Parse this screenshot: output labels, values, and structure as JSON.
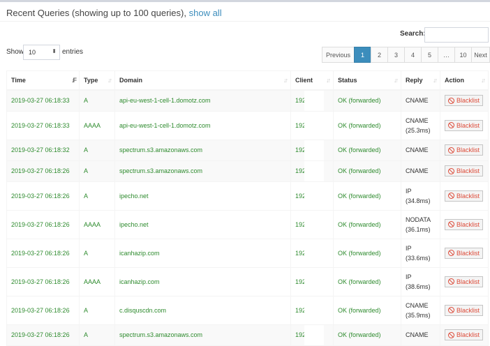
{
  "header": {
    "title": "Recent Queries (showing up to 100 queries),",
    "show_all": "show all"
  },
  "controls": {
    "search_label": "Search:",
    "search_value": "",
    "show_label": "Show",
    "entries_value": "10",
    "entries_label": "entries"
  },
  "pagination": {
    "previous": "Previous",
    "pages": [
      "1",
      "2",
      "3",
      "4",
      "5",
      "…",
      "10"
    ],
    "next": "Next",
    "active": "1"
  },
  "table": {
    "columns": [
      "Time",
      "Type",
      "Domain",
      "Client",
      "Status",
      "Reply",
      "Action"
    ],
    "action_label": "Blacklist",
    "rows": [
      {
        "time": "2019-03-27 06:18:33",
        "type": "A",
        "domain": "api-eu-west-1-cell-1.domotz.com",
        "client": "192",
        "status": "OK (forwarded)",
        "reply": "CNAME",
        "reply_time": ""
      },
      {
        "time": "2019-03-27 06:18:33",
        "type": "AAAA",
        "domain": "api-eu-west-1-cell-1.domotz.com",
        "client": "192",
        "status": "OK (forwarded)",
        "reply": "CNAME",
        "reply_time": "(25.3ms)"
      },
      {
        "time": "2019-03-27 06:18:32",
        "type": "A",
        "domain": "spectrum.s3.amazonaws.com",
        "client": "192",
        "status": "OK (forwarded)",
        "reply": "CNAME",
        "reply_time": ""
      },
      {
        "time": "2019-03-27 06:18:26",
        "type": "A",
        "domain": "spectrum.s3.amazonaws.com",
        "client": "192",
        "status": "OK (forwarded)",
        "reply": "CNAME",
        "reply_time": ""
      },
      {
        "time": "2019-03-27 06:18:26",
        "type": "A",
        "domain": "ipecho.net",
        "client": "192",
        "status": "OK (forwarded)",
        "reply": "IP",
        "reply_time": "(34.8ms)"
      },
      {
        "time": "2019-03-27 06:18:26",
        "type": "AAAA",
        "domain": "ipecho.net",
        "client": "192",
        "status": "OK (forwarded)",
        "reply": "NODATA",
        "reply_time": "(36.1ms)"
      },
      {
        "time": "2019-03-27 06:18:26",
        "type": "A",
        "domain": "icanhazip.com",
        "client": "192",
        "status": "OK (forwarded)",
        "reply": "IP",
        "reply_time": "(33.6ms)"
      },
      {
        "time": "2019-03-27 06:18:26",
        "type": "AAAA",
        "domain": "icanhazip.com",
        "client": "192",
        "status": "OK (forwarded)",
        "reply": "IP",
        "reply_time": "(38.6ms)"
      },
      {
        "time": "2019-03-27 06:18:26",
        "type": "A",
        "domain": "c.disquscdn.com",
        "client": "192",
        "status": "OK (forwarded)",
        "reply": "CNAME",
        "reply_time": "(35.9ms)"
      },
      {
        "time": "2019-03-27 06:18:26",
        "type": "A",
        "domain": "spectrum.s3.amazonaws.com",
        "client": "192",
        "status": "OK (forwarded)",
        "reply": "CNAME",
        "reply_time": ""
      }
    ]
  },
  "colors": {
    "link": "#3c8dbc",
    "ok_green": "#2e8b2e",
    "danger_red": "#dd4b39",
    "active_page": "#3c8dbc"
  },
  "icons": {
    "sort": "sort-icon",
    "blacklist": "ban-icon"
  }
}
